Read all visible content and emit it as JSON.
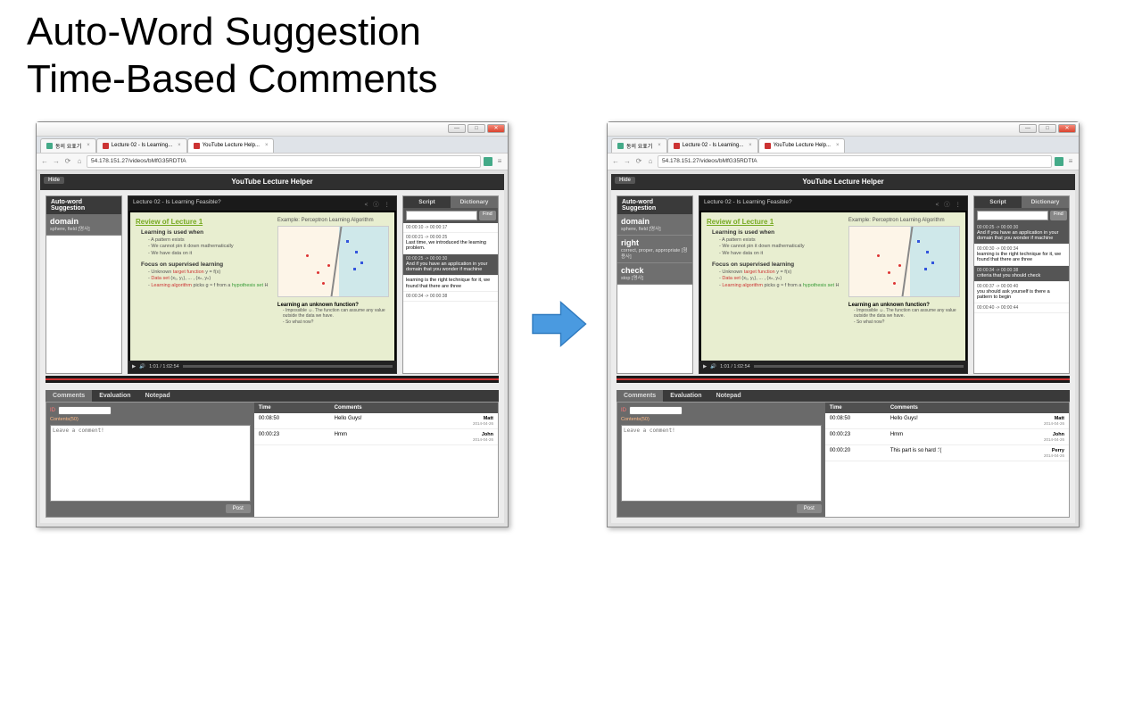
{
  "slide_title_l1": "Auto-Word Suggestion",
  "slide_title_l2": "Time-Based Comments",
  "browser": {
    "url": "54.178.151.27/videos/bMfG35RDTfA",
    "tabs": [
      "동의 요표기",
      "Lecture 02 - Is Learning...",
      "YouTube Lecture Help..."
    ],
    "win_min": "—",
    "win_max": "□",
    "win_close": "✕"
  },
  "app": {
    "title": "YouTube Lecture Helper",
    "hide": "Hide"
  },
  "autoword": {
    "header": "Auto-word Suggestion",
    "left_words": [
      {
        "w": "domain",
        "d": "sphere, field\n[명사]"
      }
    ],
    "right_words": [
      {
        "w": "domain",
        "d": "sphere, field\n[명사]"
      },
      {
        "w": "right",
        "d": "correct, proper, appropriate\n[형용사]"
      },
      {
        "w": "check",
        "d": "stop\n[명사]"
      }
    ]
  },
  "video": {
    "title": "Lecture 02 - Is Learning Feasible?",
    "slide_heading": "Review of Lecture 1",
    "bullet1": "Learning is used when",
    "sub1a": "- A pattern exists",
    "sub1b": "- We cannot pin it down mathematically",
    "sub1c": "- We have data on it",
    "bullet2": "Focus on supervised learning",
    "sub2a_pre": "- Unknown ",
    "sub2a_red": "target function",
    "sub2a_post": " y = f(x)",
    "sub2b_pre": "- ",
    "sub2b_red": "Data set",
    "sub2b_post": " (x₁, y₁), ... , (xₙ, yₙ)",
    "sub2c_pre": "- ",
    "sub2c_red": "Learning algorithm",
    "sub2c_mid": " picks g ≈ f from a ",
    "sub2c_grn": "hypothesis set",
    "sub2c_post": " H",
    "right_caption": "Example: Perceptron Learning Algorithm",
    "q_head": "Learning an unknown function?",
    "q_sub1": "- Impossible ☺. The function can assume any value outside the data we have.",
    "q_sub2": "- So what now?",
    "time": "1:01 / 1:02:54",
    "play": "▶",
    "vol": "🔊"
  },
  "script": {
    "tab1": "Script",
    "tab2": "Dictionary",
    "find": "Find",
    "left_segments": [
      {
        "ts": "00:00:10 -> 00:00:17",
        "txt": ""
      },
      {
        "ts": "00:00:21 -> 00:00:25",
        "txt": "Last time, we introduced the learning problem."
      },
      {
        "ts": "00:00:25 -> 00:00:30",
        "txt": "And if you have an application in your domain that you wonder if machine",
        "hl": true
      },
      {
        "ts": "",
        "txt": "learning is the right technique for it, we found that there are three"
      },
      {
        "ts": "00:00:34 -> 00:00:38",
        "txt": ""
      }
    ],
    "right_segments": [
      {
        "ts": "00:00:25 -> 00:00:30",
        "txt": "And if you have an application in your domain that you wonder if machine",
        "hl": true
      },
      {
        "ts": "00:00:30 -> 00:00:34",
        "txt": "learning is the right technique for it, we found that there are three"
      },
      {
        "ts": "00:00:34 -> 00:00:38",
        "txt": "criteria that you should check",
        "hl": true
      },
      {
        "ts": "00:00:37 -> 00:00:40",
        "txt": "you should ask yourself is there a pattern to begin"
      },
      {
        "ts": "00:00:40 -> 00:00:44",
        "txt": ""
      }
    ]
  },
  "comments": {
    "tabs": [
      "Comments",
      "Evaluation",
      "Notepad"
    ],
    "id_label": "ID",
    "contents_label": "Contents(50)",
    "placeholder": "Leave a comment!",
    "post": "Post",
    "cols": {
      "time": "Time",
      "comments": "Comments"
    },
    "left_rows": [
      {
        "time": "00:08:50",
        "txt": "Hello Guys!",
        "user": "Matt",
        "date": "2014-04-26"
      },
      {
        "time": "00:00:23",
        "txt": "Hmm",
        "user": "John",
        "date": "2014-04-26"
      }
    ],
    "right_rows": [
      {
        "time": "00:08:50",
        "txt": "Hello Guys!",
        "user": "Matt",
        "date": "2014-04-26"
      },
      {
        "time": "00:00:23",
        "txt": "Hmm",
        "user": "John",
        "date": "2014-04-26"
      },
      {
        "time": "00:00:20",
        "txt": "This part is so hard :'(",
        "user": "Perry",
        "date": "2014-04-26"
      }
    ]
  }
}
